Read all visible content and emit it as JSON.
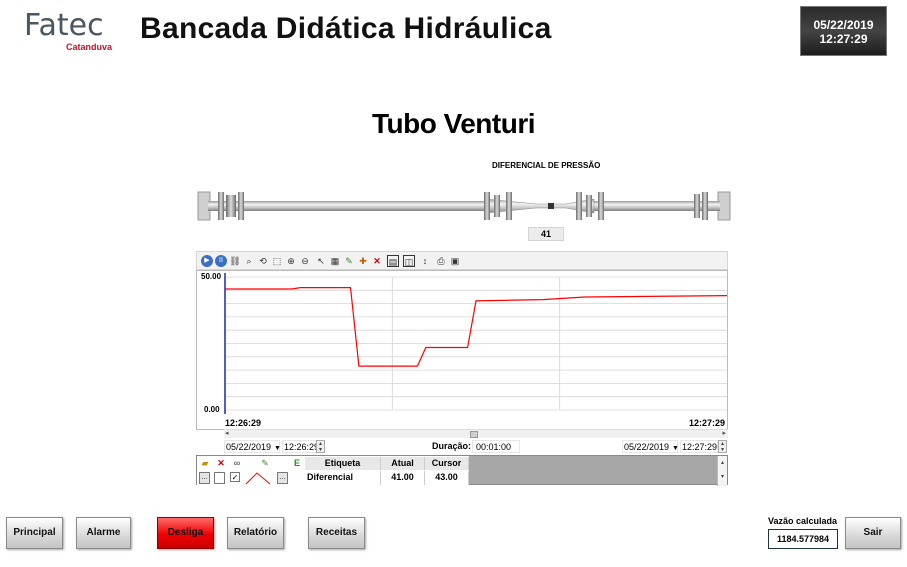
{
  "header": {
    "logo_text": "Fatec",
    "logo_sub": "Catanduva",
    "title": "Bancada Didática Hidráulica",
    "date": "05/22/2019",
    "time": "12:27:29"
  },
  "main": {
    "title": "Tubo Venturi",
    "pressure_label": "DIFERENCIAL DE PRESSÃO",
    "pressure_value": "41"
  },
  "trend": {
    "y_max_label": "50.00",
    "y_min_label": "0.00",
    "x_start_label": "12:26:29",
    "x_end_label": "12:27:29",
    "start_date": "05/22/2019",
    "start_time": "12:26:29",
    "duration_label": "Duração:",
    "duration_value": "00:01:00",
    "end_date": "05/22/2019",
    "end_time": "12:27:29",
    "toolbar_icons": [
      "play-icon",
      "pause-icon",
      "link-icon",
      "zoom-area-icon",
      "zoom-reset-icon",
      "zoom-box-icon",
      "zoom-in-icon",
      "zoom-out-icon",
      "cursor-icon",
      "grid-icon",
      "pen-icon",
      "add-icon",
      "delete-icon",
      "layout-1-icon",
      "layout-2-icon",
      "fit-icon",
      "print-icon",
      "export-icon"
    ],
    "pens_table": {
      "headers": [
        "Etiqueta",
        "Atual",
        "Cursor"
      ],
      "rows": [
        {
          "label": "Diferencial",
          "current": "41.00",
          "cursor": "43.00",
          "checked": true,
          "color": "#ff0000"
        }
      ]
    }
  },
  "chart_data": {
    "type": "line",
    "x": [
      "12:26:29",
      "12:26:37",
      "12:26:38",
      "12:26:44",
      "12:26:45",
      "12:26:52",
      "12:26:53",
      "12:26:58",
      "12:26:59",
      "12:27:07",
      "12:27:12",
      "12:27:29"
    ],
    "series": [
      {
        "name": "Diferencial",
        "color": "#ff0000",
        "values": [
          45.5,
          45.5,
          46,
          46,
          16.5,
          16.5,
          23.5,
          23.5,
          41,
          41.5,
          42.5,
          43
        ]
      }
    ],
    "ylim": [
      0,
      50
    ],
    "grid": true
  },
  "footer": {
    "buttons": [
      {
        "label": "Principal"
      },
      {
        "label": "Alarme"
      },
      {
        "label": "Desliga"
      },
      {
        "label": "Relatório"
      },
      {
        "label": "Receitas"
      }
    ],
    "flow_label": "Vazão calculada",
    "flow_value": "1184.577984",
    "exit_label": "Sair",
    "colors": {
      "off_button": "#f00000"
    }
  }
}
